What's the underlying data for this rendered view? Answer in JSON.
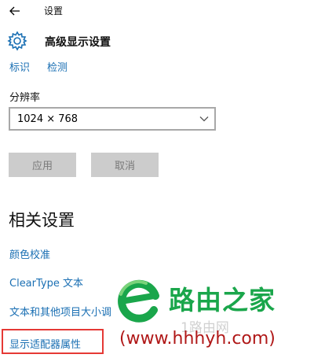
{
  "window": {
    "title": "设置"
  },
  "header": {
    "title": "高级显示设置"
  },
  "links_top": {
    "identify": "标识",
    "detect": "检测"
  },
  "resolution": {
    "label": "分辨率",
    "value": "1024 × 768"
  },
  "buttons": {
    "apply": "应用",
    "cancel": "取消"
  },
  "related": {
    "title": "相关设置",
    "items": [
      "颜色校准",
      "ClearType 文本",
      "文本和其他项目大小调",
      "显示适配器属性"
    ]
  },
  "watermark": {
    "name": "路由之家",
    "sub": "1路由网",
    "url": "(www.hhhyh.com)"
  },
  "colors": {
    "link": "#1a6fb3",
    "highlight": "#e53935",
    "watermark_green": "#1aa64b",
    "watermark_url": "#b01818"
  },
  "icons": {
    "back": "back-arrow-icon",
    "settings": "gear-icon",
    "dropdown": "chevron-down-icon",
    "logo": "router-home-logo"
  }
}
